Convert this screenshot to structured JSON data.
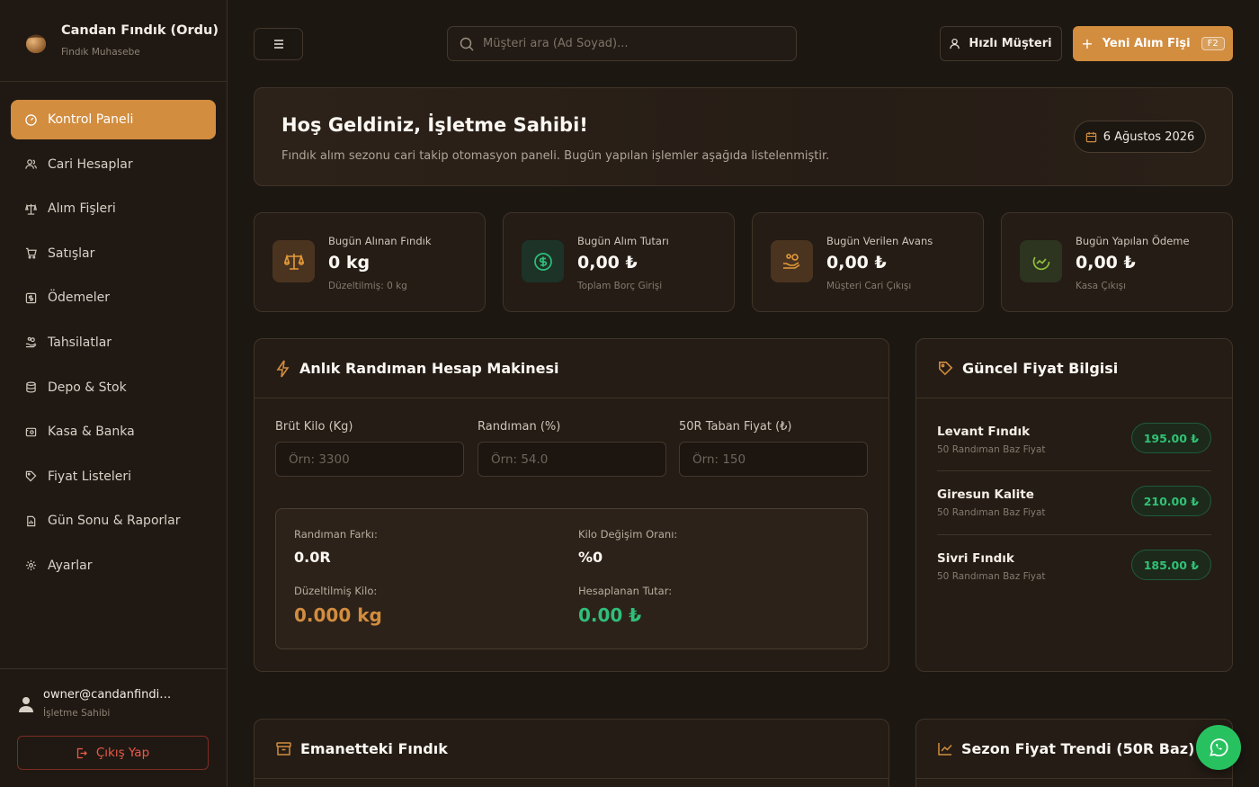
{
  "brand": {
    "title": "Candan Fındık (Ordu)",
    "subtitle": "Findık Muhasebe"
  },
  "nav": [
    {
      "label": "Kontrol Paneli",
      "icon": "dashboard-icon",
      "active": true
    },
    {
      "label": "Cari Hesaplar",
      "icon": "users-icon"
    },
    {
      "label": "Alım Fişleri",
      "icon": "scale-icon"
    },
    {
      "label": "Satışlar",
      "icon": "cart-icon"
    },
    {
      "label": "Ödemeler",
      "icon": "money-icon"
    },
    {
      "label": "Tahsilatlar",
      "icon": "hand-coins-icon"
    },
    {
      "label": "Depo & Stok",
      "icon": "database-icon"
    },
    {
      "label": "Kasa & Banka",
      "icon": "wallet-icon"
    },
    {
      "label": "Fiyat Listeleri",
      "icon": "tag-icon"
    },
    {
      "label": "Gün Sonu & Raporlar",
      "icon": "report-icon"
    },
    {
      "label": "Ayarlar",
      "icon": "gear-icon"
    }
  ],
  "user": {
    "email": "owner@candanfindik.com",
    "role": "İşletme Sahibi",
    "logout_label": "Çıkış Yap"
  },
  "topbar": {
    "search_placeholder": "Müşteri ara (Ad Soyad)...",
    "quick_customer_label": "Hızlı Müşteri",
    "new_receipt_label": "Yeni Alım Fişi",
    "new_receipt_shortcut": "F2"
  },
  "welcome": {
    "title": "Hoş Geldiniz, İşletme Sahibi!",
    "subtitle": "Fındık alım sezonu cari takip otomasyon paneli. Bugün yapılan işlemler aşağıda listelenmiştir.",
    "date": "6 Ağustos 2026"
  },
  "stats": [
    {
      "label": "Bugün Alınan Fındık",
      "value": "0 kg",
      "sub": "Düzeltilmiş: 0 kg",
      "icon": "scale-icon",
      "color": "#d28d3f"
    },
    {
      "label": "Bugün Alım Tutarı",
      "value": "0,00 ₺",
      "sub": "Toplam Borç Girişi",
      "icon": "dollar-circle-icon",
      "color": "#2fbf7a"
    },
    {
      "label": "Bugün Verilen Avans",
      "value": "0,00 ₺",
      "sub": "Müşteri Cari Çıkışı",
      "icon": "hand-coins-icon",
      "color": "#e49a3a"
    },
    {
      "label": "Bugün Yapılan Ödeme",
      "value": "0,00 ₺",
      "sub": "Kasa Çıkışı",
      "icon": "trend-circle-icon",
      "color": "#8fbe3c"
    }
  ],
  "calculator": {
    "title": "Anlık Randıman Hesap Makinesi",
    "fields": [
      {
        "label": "Brüt Kilo (Kg)",
        "placeholder": "Örn: 3300"
      },
      {
        "label": "Randıman (%)",
        "placeholder": "Örn: 54.0"
      },
      {
        "label": "50R Taban Fiyat (₺)",
        "placeholder": "Örn: 150"
      }
    ],
    "results": {
      "diff_label": "Randıman Farkı:",
      "diff_value": "0.0R",
      "rate_label": "Kilo Değişim Oranı:",
      "rate_value": "%0",
      "adjusted_label": "Düzeltilmiş Kilo:",
      "adjusted_value": "0.000 kg",
      "amount_label": "Hesaplanan Tutar:",
      "amount_value": "0.00 ₺"
    }
  },
  "prices": {
    "title": "Güncel Fiyat Bilgisi",
    "items": [
      {
        "name": "Levant Fındık",
        "desc": "50 Randıman Baz Fiyat",
        "price": "195.00 ₺"
      },
      {
        "name": "Giresun Kalite",
        "desc": "50 Randıman Baz Fiyat",
        "price": "210.00 ₺"
      },
      {
        "name": "Sivri Fındık",
        "desc": "50 Randıman Baz Fiyat",
        "price": "185.00 ₺"
      }
    ]
  },
  "escrow": {
    "title": "Emanetteki Fındık"
  },
  "trend": {
    "title": "Sezon Fiyat Trendi (50R Baz)"
  },
  "colors": {
    "accent": "#d28d3f",
    "success": "#2fbf7a",
    "danger": "#ea5a4a",
    "whatsapp": "#27c25f"
  }
}
